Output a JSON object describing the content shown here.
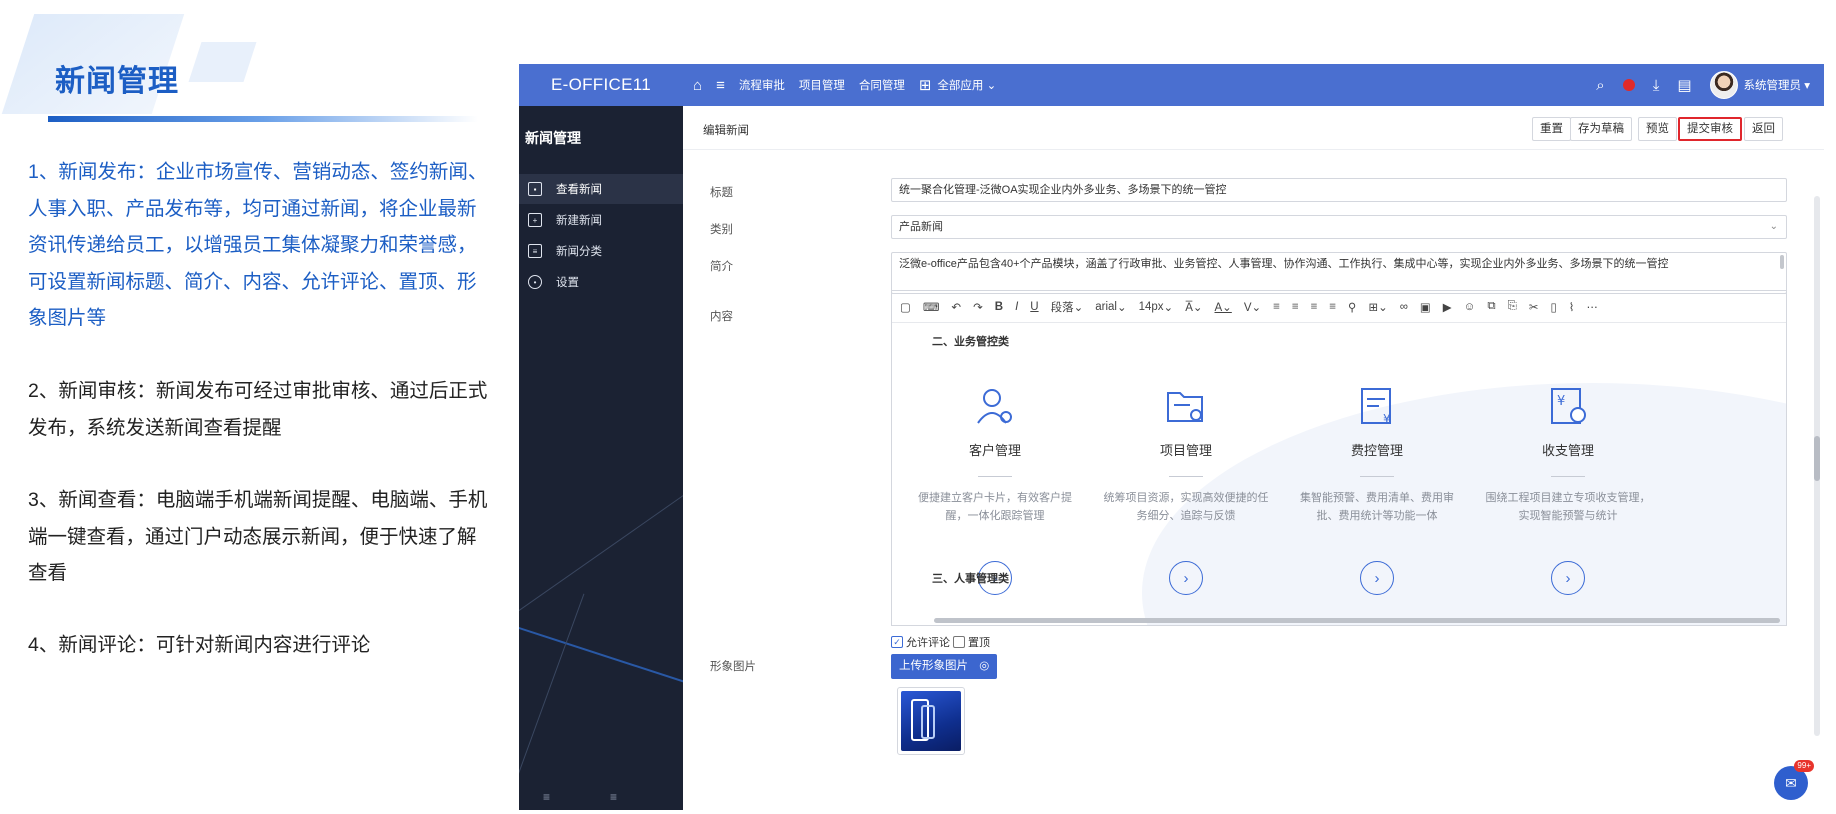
{
  "left": {
    "title": "新闻管理",
    "paragraphs": [
      "1、新闻发布：企业市场宣传、营销动态、签约新闻、人事入职、产品发布等，均可通过新闻，将企业最新资讯传递给员工，以增强员工集体凝聚力和荣誉感，可设置新闻标题、简介、内容、允许评论、置顶、形象图片等",
      "2、新闻审核：新闻发布可经过审批审核、通过后正式发布，系统发送新闻查看提醒",
      "3、新闻查看：电脑端手机端新闻提醒、电脑端、手机端一键查看，通过门户动态展示新闻，便于快速了解查看",
      "4、新闻评论：可针对新闻内容进行评论"
    ]
  },
  "topbar": {
    "brand": "E-OFFICE11",
    "links": [
      "流程审批",
      "项目管理",
      "合同管理"
    ],
    "all_apps": "全部应用",
    "user_name": "系统管理员",
    "color": "#4a6fd0"
  },
  "sidebar": {
    "title": "新闻管理",
    "items": [
      {
        "label": "查看新闻",
        "icon": "view-news-icon"
      },
      {
        "label": "新建新闻",
        "icon": "new-news-icon"
      },
      {
        "label": "新闻分类",
        "icon": "category-icon"
      },
      {
        "label": "设置",
        "icon": "settings-icon"
      }
    ]
  },
  "main": {
    "breadcrumb": "编辑新闻",
    "buttons": {
      "reset": "重置",
      "draft": "存为草稿",
      "preview": "预览",
      "submit": "提交审核",
      "back": "返回"
    },
    "form": {
      "title_label": "标题",
      "title_value": "统一聚合化管理-泛微OA实现企业内外多业务、多场景下的统一管控",
      "category_label": "类别",
      "category_value": "产品新闻",
      "summary_label": "简介",
      "summary_value": "泛微e-office产品包含40+个产品模块，涵盖了行政审批、业务管控、人事管理、协作沟通、工作执行、集成中心等，实现企业内外多业务、多场景下的统一管控",
      "content_label": "内容",
      "image_label": "形象图片",
      "upload_label": "上传形象图片",
      "allow_comment": "允许评论",
      "pin_top": "置顶"
    },
    "toolbar": {
      "paragraph": "段落",
      "font": "arial",
      "size": "14px"
    },
    "editor": {
      "section2": "二、业务管控类",
      "section3": "三、人事管理类",
      "modules": [
        {
          "name": "客户管理",
          "desc": "便捷建立客户卡片，有效客户提醒，一体化跟踪管理"
        },
        {
          "name": "项目管理",
          "desc": "统筹项目资源，实现高效便捷的任务细分、追踪与反馈"
        },
        {
          "name": "费控管理",
          "desc": "集智能预警、费用清单、费用审批、费用统计等功能一体"
        },
        {
          "name": "收支管理",
          "desc": "围绕工程项目建立专项收支管理，实现智能预警与统计"
        }
      ]
    },
    "chat_badge": "99+"
  }
}
